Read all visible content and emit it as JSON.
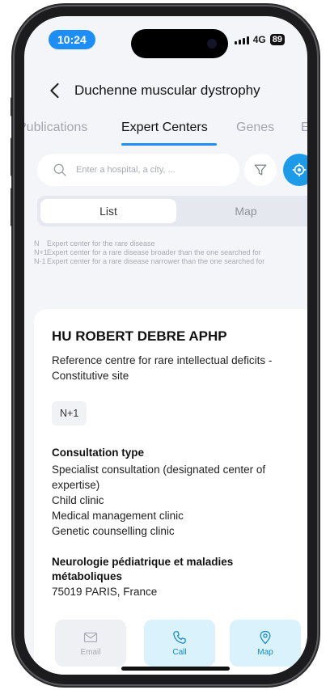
{
  "status_bar": {
    "time": "10:24",
    "network": "4G",
    "battery": "89"
  },
  "header": {
    "title": "Duchenne muscular dystrophy",
    "back_icon": "chevron-left-icon"
  },
  "tabs": [
    {
      "label": "Publications",
      "active": false
    },
    {
      "label": "Expert Centers",
      "active": true
    },
    {
      "label": "Genes",
      "active": false
    },
    {
      "label": "Epi",
      "active": false
    }
  ],
  "search": {
    "placeholder": "Enter a hospital, a city, ...",
    "value": ""
  },
  "segmented": {
    "list_label": "List",
    "map_label": "Map",
    "selected": "List"
  },
  "legend": [
    {
      "code": "N",
      "text": "Expert center for the rare disease"
    },
    {
      "code": "N+1",
      "text": "Expert center for a rare disease broader than the one searched for"
    },
    {
      "code": "N-1",
      "text": "Expert center for a rare disease narrower than the one searched for"
    }
  ],
  "card": {
    "name": "HU ROBERT DEBRE APHP",
    "description": "Reference centre for rare intellectual deficits - Constitutive site",
    "level": "N+1",
    "consultation_title": "Consultation type",
    "consultation_types": [
      "Specialist consultation (designated center of expertise)",
      "Child clinic",
      "Medical management clinic",
      "Genetic counselling clinic"
    ],
    "department": "Neurologie pédiatrique et maladies métaboliques",
    "address": "75019 PARIS, France"
  },
  "actions": {
    "email": "Email",
    "call": "Call",
    "map": "Map"
  },
  "colors": {
    "accent": "#1d8ef5",
    "locate_button": "#1d9be8",
    "action_bg": "#d9f2fb",
    "action_text": "#1588c9"
  }
}
